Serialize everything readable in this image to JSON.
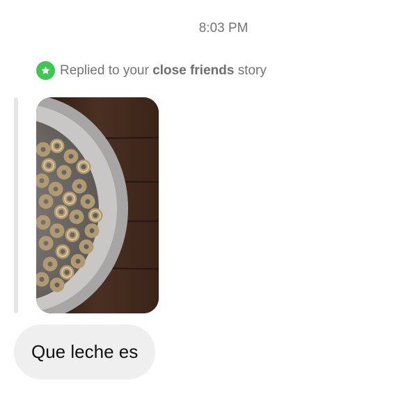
{
  "thread": {
    "timestamp": "8:03 PM"
  },
  "story_reply": {
    "prefix": "Replied to your",
    "highlight": "close friends",
    "suffix": "story",
    "badge_icon": "star-icon",
    "badge_color": "#3ec84f",
    "thumbnail_description": "bowl-of-cereal-image"
  },
  "message": {
    "text": "Que leche es"
  }
}
